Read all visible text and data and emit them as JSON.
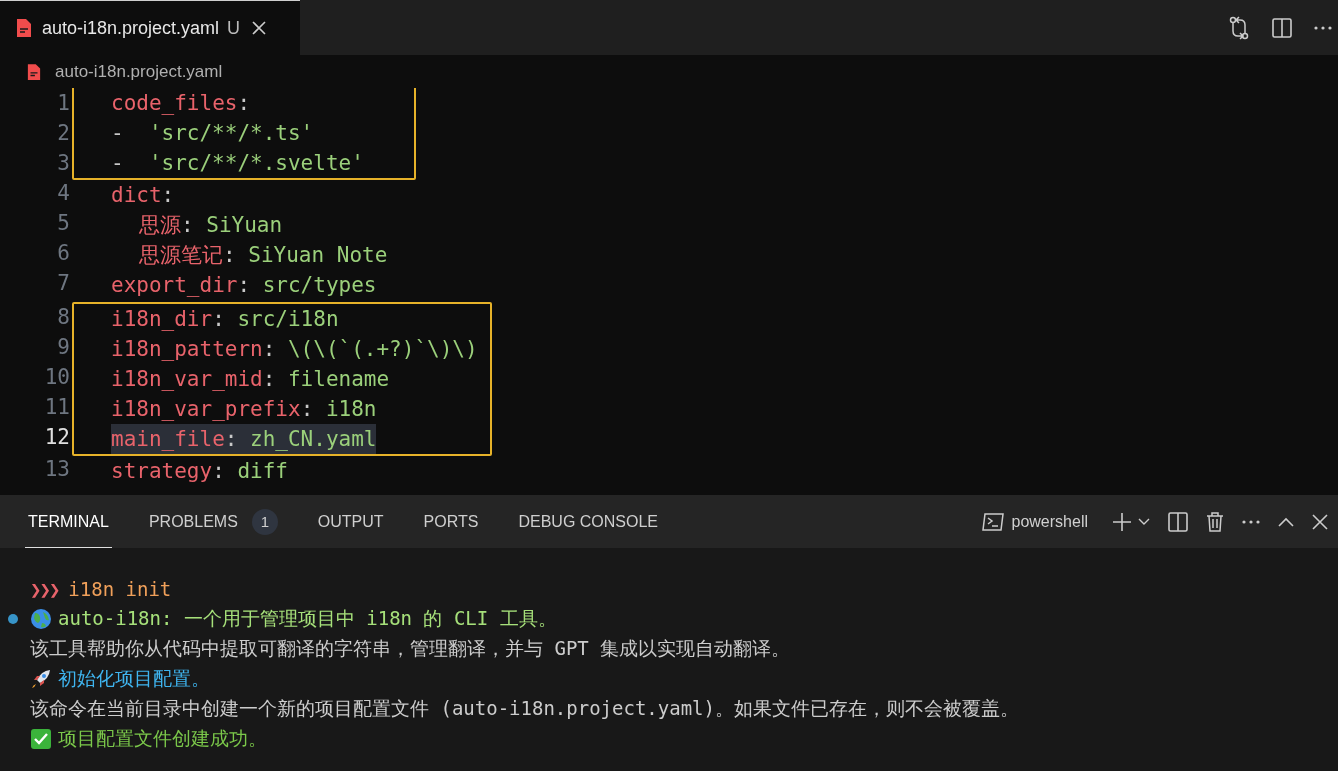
{
  "editor_tab": {
    "title": "auto-i18n.project.yaml",
    "status": "U",
    "selected": true
  },
  "breadcrumb": "auto-i18n.project.yaml",
  "code": {
    "groups": [
      {
        "boxed": true,
        "lines": [
          {
            "number": "1",
            "kind": "key",
            "key": "code_files",
            "punct": ":",
            "current": false
          },
          {
            "number": "2",
            "kind": "item",
            "dash": "-",
            "value": "'src/**/*.ts'",
            "current": false
          },
          {
            "number": "3",
            "kind": "item",
            "dash": "-",
            "value": "'src/**/*.svelte'",
            "current": false
          }
        ]
      },
      {
        "boxed": false,
        "lines": [
          {
            "number": "4",
            "kind": "key",
            "key": "dict",
            "punct": ":",
            "current": false,
            "children": [
              {
                "number": "5",
                "kind": "key",
                "key": "思源",
                "punct": ":",
                "value": "SiYuan",
                "current": false
              },
              {
                "number": "6",
                "kind": "key",
                "key": "思源笔记",
                "punct": ":",
                "value": "SiYuan Note",
                "current": false
              }
            ]
          },
          {
            "number": "7",
            "kind": "key",
            "key": "export_dir",
            "punct": ":",
            "value": "src/types",
            "current": false
          }
        ]
      },
      {
        "boxed": true,
        "lines": [
          {
            "number": "8",
            "kind": "key",
            "key": "i18n_dir",
            "punct": ":",
            "value": "src/i18n",
            "current": false
          },
          {
            "number": "9",
            "kind": "key",
            "key": "i18n_pattern",
            "punct": ":",
            "value": "\\(\\(`(.+?)`\\)\\)",
            "current": false
          },
          {
            "number": "10",
            "kind": "key",
            "key": "i18n_var_mid",
            "punct": ":",
            "value": "filename",
            "current": false
          },
          {
            "number": "11",
            "kind": "key",
            "key": "i18n_var_prefix",
            "punct": ":",
            "value": "i18n",
            "current": false
          },
          {
            "number": "12",
            "kind": "key",
            "key": "main_file",
            "punct": ":",
            "value": "zh_CN.yaml",
            "current": true
          }
        ]
      },
      {
        "boxed": false,
        "lines": [
          {
            "number": "13",
            "kind": "key",
            "key": "strategy",
            "punct": ":",
            "value": "diff",
            "current": false
          }
        ]
      }
    ]
  },
  "panel_tabs": [
    {
      "label": "TERMINAL",
      "selected": true
    },
    {
      "label": "PROBLEMS",
      "selected": false,
      "badge": "1"
    },
    {
      "label": "OUTPUT",
      "selected": false
    },
    {
      "label": "PORTS",
      "selected": false
    },
    {
      "label": "DEBUG CONSOLE",
      "selected": false
    }
  ],
  "terminal_profile": "powershell",
  "terminal": [
    {
      "kind": "prompt",
      "prompt": "❯❯❯",
      "text": "i18n init"
    },
    {
      "kind": "intro",
      "marker": true,
      "text": "auto-i18n: 一个用于管理项目中 i18n 的 CLI 工具。"
    },
    {
      "kind": "plain",
      "marker": false,
      "text": "该工具帮助你从代码中提取可翻译的字符串，管理翻译，并与 GPT 集成以实现自动翻译。"
    },
    {
      "kind": "step",
      "marker": false,
      "text": "初始化项目配置。"
    },
    {
      "kind": "plain",
      "marker": false,
      "text": "该命令在当前目录中创建一个新的项目配置文件 (auto-i18n.project.yaml)。如果文件已存在，则不会被覆盖。"
    },
    {
      "kind": "success",
      "marker": false,
      "text": "项目配置文件创建成功。"
    }
  ]
}
